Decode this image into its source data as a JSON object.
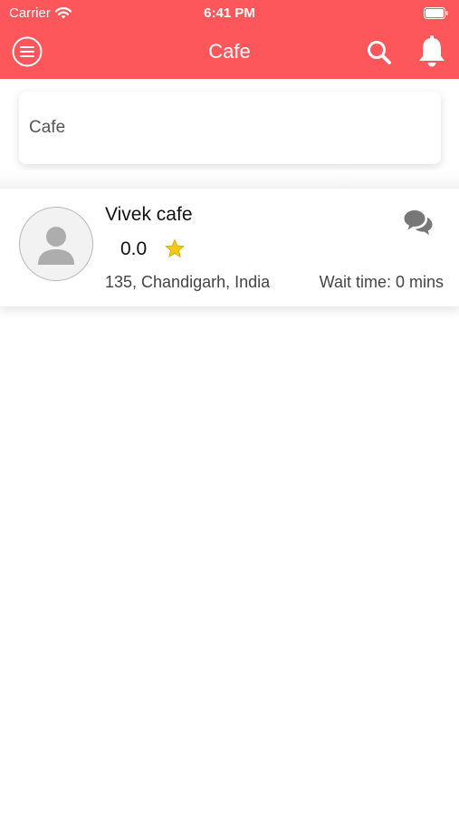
{
  "status_bar": {
    "carrier": "Carrier",
    "time": "6:41 PM",
    "wifi_icon": "wifi-icon",
    "battery_icon": "battery-icon"
  },
  "navbar": {
    "title": "Cafe",
    "menu_icon": "menu-icon",
    "search_icon": "search-icon",
    "bell_icon": "bell-icon"
  },
  "search": {
    "value": "Cafe",
    "placeholder": ""
  },
  "results": [
    {
      "name": "Vivek cafe",
      "rating": "0.0",
      "address": "135, Chandigarh, India",
      "wait_time": "Wait time: 0 mins",
      "avatar_icon": "avatar-placeholder-icon",
      "star_icon": "star-icon",
      "chat_icon": "chat-icon"
    }
  ],
  "colors": {
    "header": "#fd575b",
    "star": "#f2c90f",
    "chat_icon": "#777777"
  }
}
